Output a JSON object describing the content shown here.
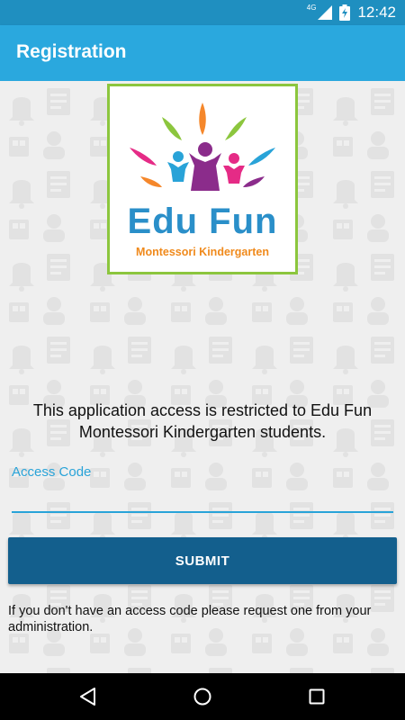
{
  "status_bar": {
    "network": "4G",
    "time": "12:42",
    "icons": [
      "signal-icon",
      "battery-charging-icon"
    ]
  },
  "app_bar": {
    "title": "Registration"
  },
  "logo": {
    "name": "Edu Fun",
    "tagline": "Montessori Kindergarten",
    "colors": {
      "border": "#8cc63e",
      "name": "#2a8fc9",
      "tagline": "#f08a1c"
    }
  },
  "main": {
    "message": "This application access is restricted to Edu Fun Montessori Kindergarten students.",
    "access_code": {
      "label": "Access Code",
      "value": ""
    },
    "submit_label": "SUBMIT",
    "help_text": "If you don't have an access code please request one from your administration."
  },
  "nav_bar": {
    "icons": [
      "back-icon",
      "home-icon",
      "recents-icon"
    ]
  },
  "colors": {
    "status_bar": "#1f8fc0",
    "app_bar": "#2aa8de",
    "accent": "#29a3d8",
    "button": "#135f8d",
    "background": "#efefef"
  }
}
